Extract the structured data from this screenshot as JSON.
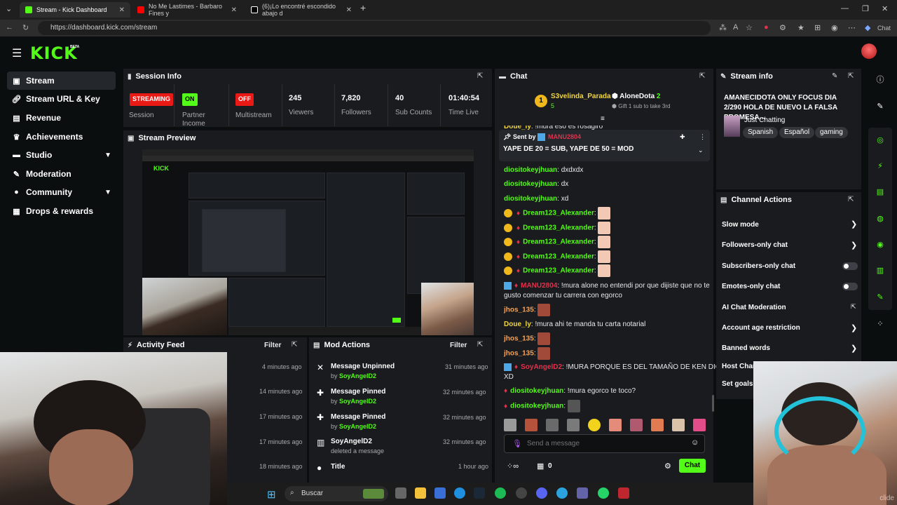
{
  "browser": {
    "tabs": [
      {
        "title": "Stream - Kick Dashboard",
        "color": "#53fc18"
      },
      {
        "title": "No Me Lastimes - Barbaro Fines y",
        "color": "#ff0000"
      },
      {
        "title": "(6)¡Lo encontré escondido abajo d",
        "color": "#ffffff"
      }
    ],
    "url": "https://dashboard.kick.com/stream",
    "chat_label": "Chat"
  },
  "header": {
    "logo": "KICK",
    "beta": "BETA"
  },
  "sidebar": {
    "items": [
      {
        "label": "Stream",
        "icon": "video-icon"
      },
      {
        "label": "Stream URL & Key",
        "icon": "link-icon"
      },
      {
        "label": "Revenue",
        "icon": "dollar-icon"
      },
      {
        "label": "Achievements",
        "icon": "trophy-icon"
      },
      {
        "label": "Studio",
        "icon": "layout-icon"
      },
      {
        "label": "Moderation",
        "icon": "wrench-icon"
      },
      {
        "label": "Community",
        "icon": "users-icon"
      },
      {
        "label": "Drops & rewards",
        "icon": "gift-icon"
      }
    ]
  },
  "session": {
    "title": "Session Info",
    "streaming_badge": "STREAMING",
    "session_label": "Session",
    "partner_badge": "ON",
    "partner_label": "Partner Income",
    "multistream_badge": "OFF",
    "multistream_label": "Multistream",
    "viewers": "245",
    "viewers_label": "Viewers",
    "followers": "7,820",
    "followers_label": "Followers",
    "subs": "40",
    "subs_label": "Sub Counts",
    "time": "01:40:54",
    "time_label": "Time Live"
  },
  "preview": {
    "title": "Stream Preview"
  },
  "activity": {
    "title": "Activity Feed",
    "filter": "Filter",
    "times": [
      "4 minutes ago",
      "14 minutes ago",
      "17 minutes ago",
      "17 minutes ago",
      "18 minutes ago"
    ]
  },
  "mod": {
    "title": "Mod Actions",
    "filter": "Filter",
    "items": [
      {
        "title": "Message Unpinned",
        "by": "by",
        "user": "SoyAngelD2",
        "time": "31 minutes ago"
      },
      {
        "title": "Message Pinned",
        "by": "by",
        "user": "SoyAngelD2",
        "time": "32 minutes ago"
      },
      {
        "title": "Message Pinned",
        "by": "by",
        "user": "SoyAngelD2",
        "time": "32 minutes ago"
      },
      {
        "title": "SoyAngelD2",
        "by": "deleted a message",
        "user": "",
        "time": "32 minutes ago"
      },
      {
        "title": "Title",
        "by": "",
        "user": "",
        "time": "1 hour ago"
      }
    ]
  },
  "chat": {
    "title": "Chat",
    "top": {
      "rank": "1",
      "user1": "S3velinda_Parada",
      "user1_count": "5",
      "user2": "AloneDota",
      "user2_count": "2",
      "gift_text": "Gift 1 sub to take 3rd"
    },
    "cut_line_user": "Doue_ly",
    "cut_line_text": "!mura eso es rosagiro",
    "pinned": {
      "sent_by": "Sent by",
      "user": "MANU2804",
      "text": "YAPE DE 20 = SUB, YAPE DE 50 = MOD"
    },
    "messages": [
      {
        "user": "diositokeyjhuan",
        "text": "dxdxdx",
        "color": "green"
      },
      {
        "user": "diositokeyjhuan",
        "text": "dx",
        "color": "green"
      },
      {
        "user": "diositokeyjhuan",
        "text": "xd",
        "color": "green"
      },
      {
        "user": "Dream123_Alexander",
        "text": "",
        "color": "green"
      },
      {
        "user": "Dream123_Alexander",
        "text": "",
        "color": "green"
      },
      {
        "user": "Dream123_Alexander",
        "text": "",
        "color": "green"
      },
      {
        "user": "Dream123_Alexander",
        "text": "",
        "color": "green"
      },
      {
        "user": "Dream123_Alexander",
        "text": "",
        "color": "green"
      },
      {
        "user": "MANU2804",
        "text": "!mura alone no entendi por que dijiste que no te",
        "text2": "gusto comenzar tu carrera con egorco",
        "color": "red"
      },
      {
        "user": "jhos_135",
        "text": "",
        "color": "orange"
      },
      {
        "user": "Doue_ly",
        "text": "!mura ahi te manda tu carta notarial",
        "color": "yellow"
      },
      {
        "user": "jhos_135",
        "text": "",
        "color": "orange"
      },
      {
        "user": "jhos_135",
        "text": "",
        "color": "orange"
      },
      {
        "user": "SoyAngelD2",
        "text": "!MURA PORQUE ES DEL TAMAÑO DE KEN DICES?",
        "text2": "XD",
        "color": "red"
      },
      {
        "user": "diositokeyjhuan",
        "text": "!mura egorco te toco?",
        "color": "green"
      },
      {
        "user": "diositokeyjhuan",
        "text": "",
        "color": "green"
      }
    ],
    "placeholder": "Send a message",
    "footer_count": "0",
    "send_label": "Chat"
  },
  "streaminfo": {
    "title": "Stream info",
    "stream_title": "AMANECIDOTA ONLY FOCUS DIA 2/290 HOLA DE NUEVO LA FALSA PROMESA...",
    "category": "Just Chatting",
    "tags": [
      "Spanish",
      "Español",
      "gaming"
    ]
  },
  "channel": {
    "title": "Channel Actions",
    "actions": [
      {
        "label": "Slow mode",
        "control": "arrow"
      },
      {
        "label": "Followers-only chat",
        "control": "arrow"
      },
      {
        "label": "Subscribers-only chat",
        "control": "toggle"
      },
      {
        "label": "Emotes-only chat",
        "control": "toggle"
      },
      {
        "label": "AI Chat Moderation",
        "control": "external"
      },
      {
        "label": "Account age restriction",
        "control": "arrow"
      },
      {
        "label": "Banned words",
        "control": "arrow"
      },
      {
        "label": "Host Chan",
        "control": "none"
      },
      {
        "label": "Set goals",
        "control": "none"
      }
    ]
  },
  "webcam": {
    "watermark": "clide"
  },
  "taskbar": {
    "search": "Buscar"
  },
  "colors": {
    "accent": "#53fc18",
    "panel": "#191b1f",
    "bg": "#0b0e0f",
    "live_red": "#e91916"
  }
}
